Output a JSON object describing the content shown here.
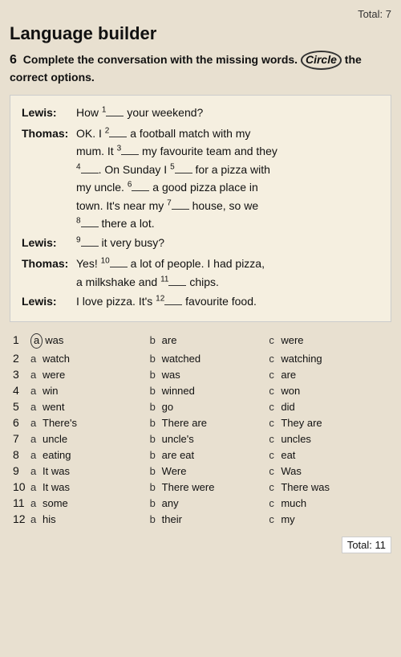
{
  "total_top": "Total: 7",
  "title": "Language builder",
  "exercise_num": "6",
  "instruction_text": "Complete the conversation with the missing words.",
  "circle_word": "Circle",
  "instruction_suffix": "the correct options.",
  "conversation": [
    {
      "speaker": "Lewis:",
      "lines": [
        {
          "text": "How ",
          "sup": "1",
          "blank": true,
          "after": " your weekend?"
        }
      ]
    },
    {
      "speaker": "Thomas:",
      "lines": [
        {
          "text": "OK. I ",
          "sup": "2",
          "blank": true,
          "after": " a football match with my"
        },
        {
          "text": "mum. It ",
          "sup": "3",
          "blank": true,
          "after": " my favourite team and they"
        },
        {
          "text": "",
          "sup": "4",
          "blank": true,
          "after": ". On Sunday I ",
          "sup2": "5",
          "blank2": true,
          "after2": " for a pizza with"
        },
        {
          "text": "my uncle. ",
          "sup": "6",
          "blank": true,
          "after": " a good pizza place in"
        },
        {
          "text": "town. It's near my ",
          "sup": "7",
          "blank": true,
          "after": " house, so we"
        },
        {
          "text": "",
          "sup": "8",
          "blank": true,
          "after": " there a lot."
        }
      ]
    },
    {
      "speaker": "Lewis:",
      "lines": [
        {
          "text": "",
          "sup": "9",
          "blank": true,
          "after": " it very busy?"
        }
      ]
    },
    {
      "speaker": "Thomas:",
      "lines": [
        {
          "text": "Yes! ",
          "sup": "10",
          "blank": true,
          "after": " a lot of people. I had pizza,"
        },
        {
          "text": "a milkshake and ",
          "sup": "11",
          "blank": true,
          "after": " chips."
        }
      ]
    },
    {
      "speaker": "Lewis:",
      "lines": [
        {
          "text": "I love pizza. It's ",
          "sup": "12",
          "blank": true,
          "after": " favourite food."
        }
      ]
    }
  ],
  "answers": [
    {
      "num": "1",
      "options": [
        {
          "label": "a",
          "text": "was",
          "circled": true
        },
        {
          "label": "b",
          "text": "are",
          "circled": false
        },
        {
          "label": "c",
          "text": "were",
          "circled": false
        }
      ]
    },
    {
      "num": "2",
      "options": [
        {
          "label": "a",
          "text": "watch",
          "circled": false
        },
        {
          "label": "b",
          "text": "watched",
          "circled": false
        },
        {
          "label": "c",
          "text": "watching",
          "circled": false
        }
      ]
    },
    {
      "num": "3",
      "options": [
        {
          "label": "a",
          "text": "were",
          "circled": false
        },
        {
          "label": "b",
          "text": "was",
          "circled": false
        },
        {
          "label": "c",
          "text": "are",
          "circled": false
        }
      ]
    },
    {
      "num": "4",
      "options": [
        {
          "label": "a",
          "text": "win",
          "circled": false
        },
        {
          "label": "b",
          "text": "winned",
          "circled": false
        },
        {
          "label": "c",
          "text": "won",
          "circled": false
        }
      ]
    },
    {
      "num": "5",
      "options": [
        {
          "label": "a",
          "text": "went",
          "circled": false
        },
        {
          "label": "b",
          "text": "go",
          "circled": false
        },
        {
          "label": "c",
          "text": "did",
          "circled": false
        }
      ]
    },
    {
      "num": "6",
      "options": [
        {
          "label": "a",
          "text": "There's",
          "circled": false
        },
        {
          "label": "b",
          "text": "There are",
          "circled": false
        },
        {
          "label": "c",
          "text": "They are",
          "circled": false
        }
      ]
    },
    {
      "num": "7",
      "options": [
        {
          "label": "a",
          "text": "uncle",
          "circled": false
        },
        {
          "label": "b",
          "text": "uncle's",
          "circled": false
        },
        {
          "label": "c",
          "text": "uncles",
          "circled": false
        }
      ]
    },
    {
      "num": "8",
      "options": [
        {
          "label": "a",
          "text": "eating",
          "circled": false
        },
        {
          "label": "b",
          "text": "are eat",
          "circled": false
        },
        {
          "label": "c",
          "text": "eat",
          "circled": false
        }
      ]
    },
    {
      "num": "9",
      "options": [
        {
          "label": "a",
          "text": "It was",
          "circled": false
        },
        {
          "label": "b",
          "text": "Were",
          "circled": false
        },
        {
          "label": "c",
          "text": "Was",
          "circled": false
        }
      ]
    },
    {
      "num": "10",
      "options": [
        {
          "label": "a",
          "text": "It was",
          "circled": false
        },
        {
          "label": "b",
          "text": "There were",
          "circled": false
        },
        {
          "label": "c",
          "text": "There was",
          "circled": false
        }
      ]
    },
    {
      "num": "11",
      "options": [
        {
          "label": "a",
          "text": "some",
          "circled": false
        },
        {
          "label": "b",
          "text": "any",
          "circled": false
        },
        {
          "label": "c",
          "text": "much",
          "circled": false
        }
      ]
    },
    {
      "num": "12",
      "options": [
        {
          "label": "a",
          "text": "his",
          "circled": false
        },
        {
          "label": "b",
          "text": "their",
          "circled": false
        },
        {
          "label": "c",
          "text": "my",
          "circled": false
        }
      ]
    }
  ],
  "total_bottom": "Total: 11"
}
